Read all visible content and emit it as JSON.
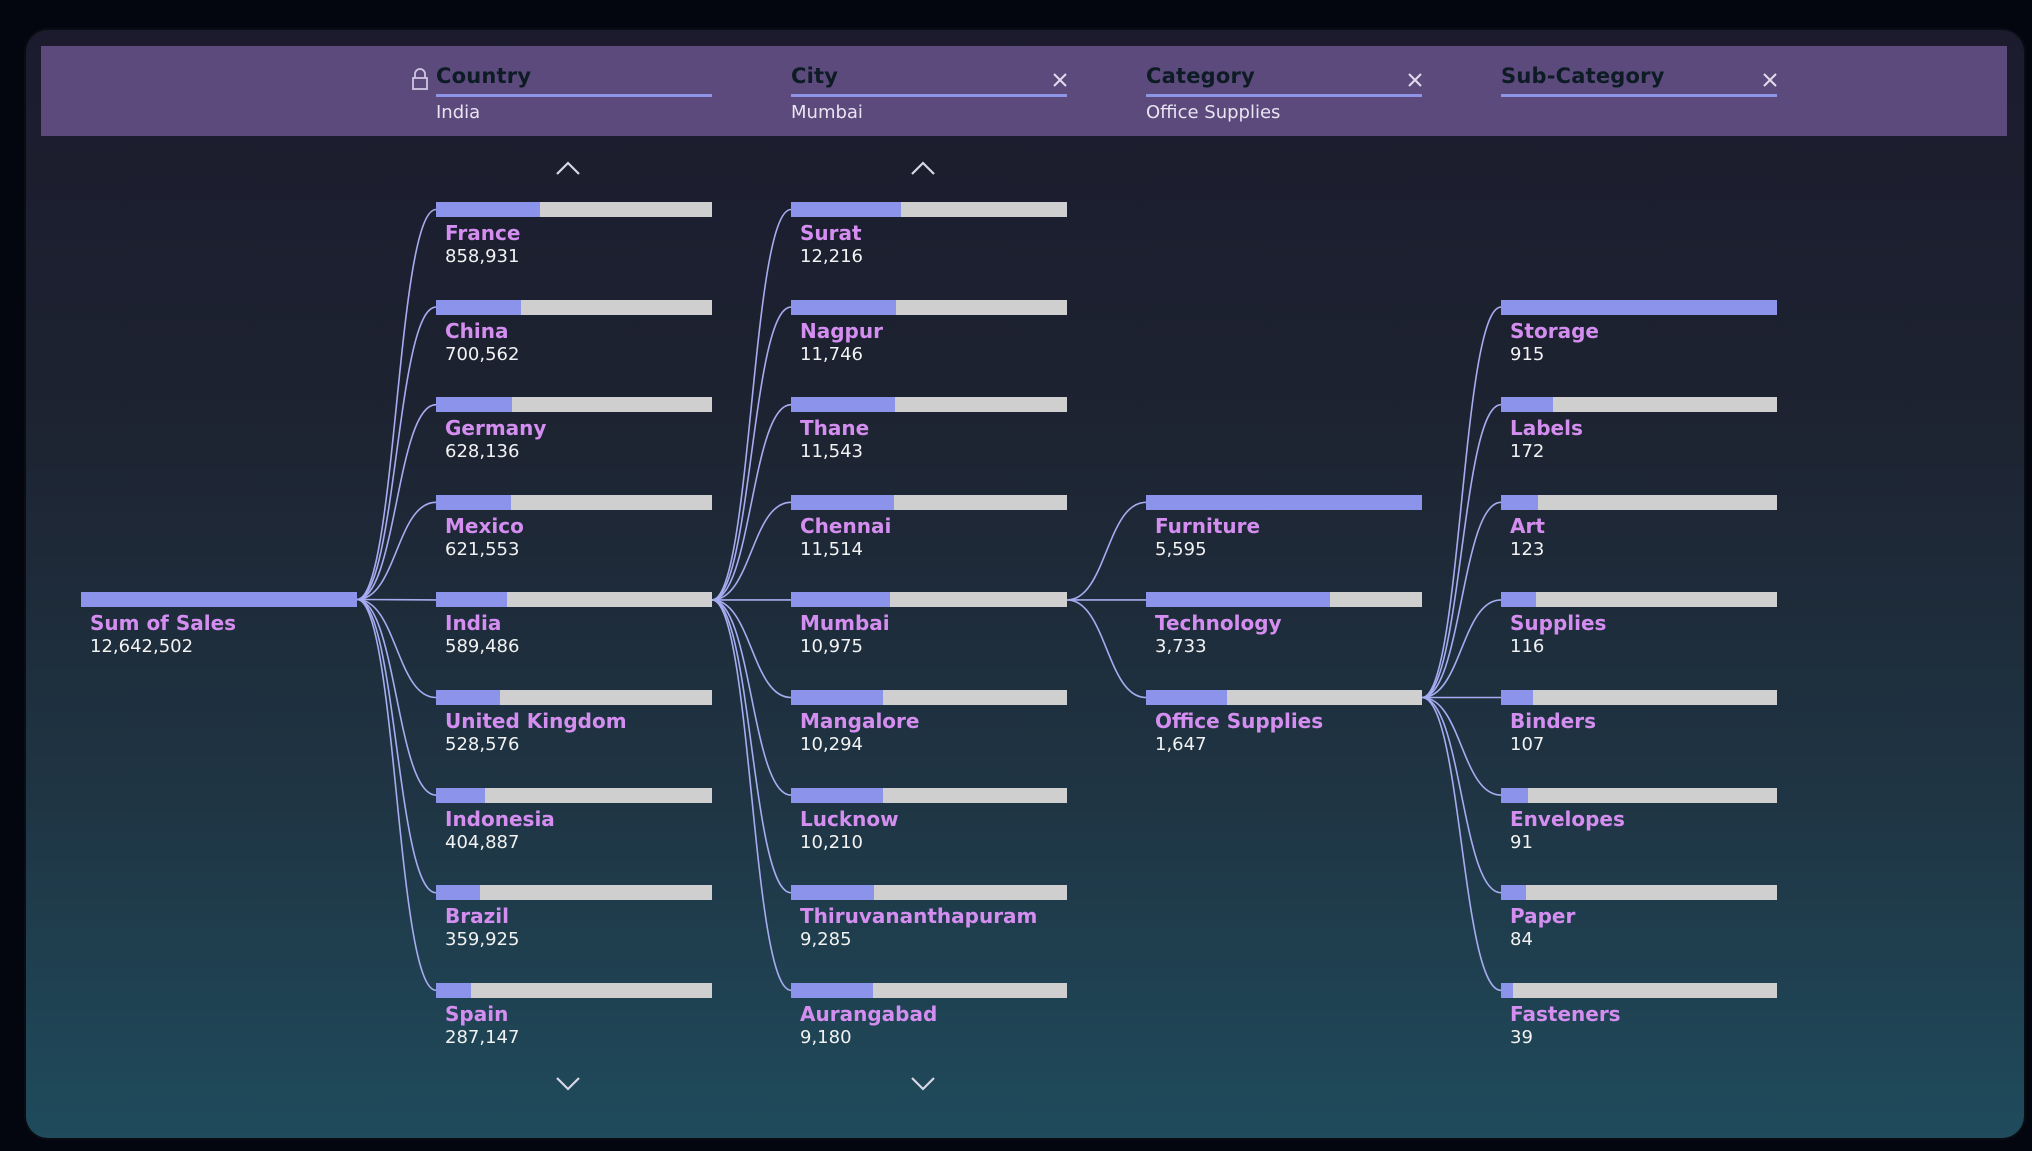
{
  "colors": {
    "fill": "#8b93ea",
    "track": "#cfcfcf",
    "label": "#d38ef0",
    "value": "#f2f2f2",
    "header_bg": "#5c4a7c",
    "header_title": "#0d1b24",
    "link": "#a7acf0"
  },
  "root": {
    "label": "Sum of Sales",
    "value": "12,642,502",
    "fill": 1.0
  },
  "levels": [
    {
      "title": "Country",
      "selected": "India",
      "locked": true,
      "closable": false,
      "scroll_up": true,
      "scroll_down": true,
      "parent_index": -1,
      "nodes": [
        {
          "label": "France",
          "value": "858,931",
          "fill": 0.376
        },
        {
          "label": "China",
          "value": "700,562",
          "fill": 0.307
        },
        {
          "label": "Germany",
          "value": "628,136",
          "fill": 0.275
        },
        {
          "label": "Mexico",
          "value": "621,553",
          "fill": 0.272
        },
        {
          "label": "India",
          "value": "589,486",
          "fill": 0.258
        },
        {
          "label": "United Kingdom",
          "value": "528,576",
          "fill": 0.231
        },
        {
          "label": "Indonesia",
          "value": "404,887",
          "fill": 0.177
        },
        {
          "label": "Brazil",
          "value": "359,925",
          "fill": 0.158
        },
        {
          "label": "Spain",
          "value": "287,147",
          "fill": 0.126
        }
      ]
    },
    {
      "title": "City",
      "selected": "Mumbai",
      "locked": false,
      "closable": true,
      "scroll_up": true,
      "scroll_down": true,
      "parent_index": 4,
      "nodes": [
        {
          "label": "Surat",
          "value": "12,216",
          "fill": 0.397
        },
        {
          "label": "Nagpur",
          "value": "11,746",
          "fill": 0.382
        },
        {
          "label": "Thane",
          "value": "11,543",
          "fill": 0.375
        },
        {
          "label": "Chennai",
          "value": "11,514",
          "fill": 0.374
        },
        {
          "label": "Mumbai",
          "value": "10,975",
          "fill": 0.357
        },
        {
          "label": "Mangalore",
          "value": "10,294",
          "fill": 0.335
        },
        {
          "label": "Lucknow",
          "value": "10,210",
          "fill": 0.332
        },
        {
          "label": "Thiruvananthapuram",
          "value": "9,285",
          "fill": 0.302
        },
        {
          "label": "Aurangabad",
          "value": "9,180",
          "fill": 0.298
        }
      ]
    },
    {
      "title": "Category",
      "selected": "Office Supplies",
      "locked": false,
      "closable": true,
      "scroll_up": false,
      "scroll_down": false,
      "parent_index": 4,
      "first_slot": 3,
      "nodes": [
        {
          "label": "Furniture",
          "value": "5,595",
          "fill": 1.0
        },
        {
          "label": "Technology",
          "value": "3,733",
          "fill": 0.667
        },
        {
          "label": "Office Supplies",
          "value": "1,647",
          "fill": 0.294
        }
      ]
    },
    {
      "title": "Sub-Category",
      "selected": "",
      "locked": false,
      "closable": true,
      "scroll_up": false,
      "scroll_down": false,
      "parent_index": 2,
      "first_slot": 1,
      "nodes": [
        {
          "label": "Storage",
          "value": "915",
          "fill": 1.0
        },
        {
          "label": "Labels",
          "value": "172",
          "fill": 0.188
        },
        {
          "label": "Art",
          "value": "123",
          "fill": 0.134
        },
        {
          "label": "Supplies",
          "value": "116",
          "fill": 0.127
        },
        {
          "label": "Binders",
          "value": "107",
          "fill": 0.117
        },
        {
          "label": "Envelopes",
          "value": "91",
          "fill": 0.099
        },
        {
          "label": "Paper",
          "value": "84",
          "fill": 0.092
        },
        {
          "label": "Fasteners",
          "value": "39",
          "fill": 0.043
        }
      ]
    }
  ]
}
